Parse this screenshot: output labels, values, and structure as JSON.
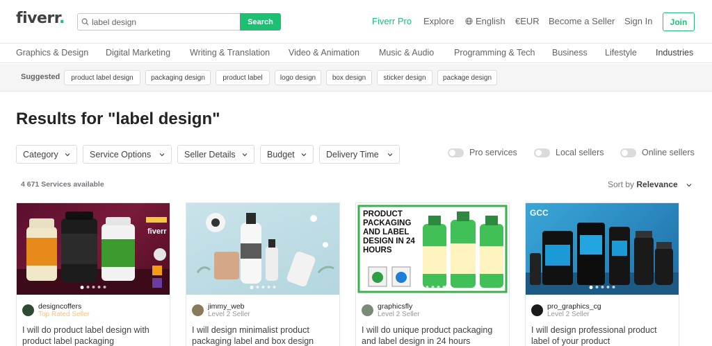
{
  "header": {
    "logo": "fiverr",
    "search": {
      "value": "label design",
      "button": "Search"
    },
    "nav": [
      "Fiverr Pro",
      "Explore",
      "English",
      "€EUR",
      "Become a Seller",
      "Sign In"
    ],
    "join": "Join"
  },
  "categories": [
    "Graphics & Design",
    "Digital Marketing",
    "Writing & Translation",
    "Video & Animation",
    "Music & Audio",
    "Programming & Tech",
    "Business",
    "Lifestyle",
    "Industries"
  ],
  "suggested": {
    "label": "Suggested",
    "chips": [
      "product label design",
      "packaging design",
      "product label",
      "logo design",
      "box design",
      "sticker design",
      "package design"
    ]
  },
  "results_title": "Results for \"label design\"",
  "filters": [
    "Category",
    "Service Options",
    "Seller Details",
    "Budget",
    "Delivery Time"
  ],
  "toggles": [
    "Pro services",
    "Local sellers",
    "Online sellers"
  ],
  "count": "4 671 Services available",
  "sort": {
    "label": "Sort by",
    "value": "Relevance"
  },
  "gigs": [
    {
      "seller": "designcoffers",
      "level": "Top Rated Seller",
      "title": "I will do product label design with product label packaging",
      "thumb_text": "fiverr"
    },
    {
      "seller": "jimmy_web",
      "level": "Level 2 Seller",
      "title": "I will design minimalist product packaging label and box design",
      "thumb_text": ""
    },
    {
      "seller": "graphicsfly",
      "level": "Level 2 Seller",
      "title": "I will do unique product packaging and label design in 24 hours",
      "thumb_text": "PRODUCT PACKAGING AND LABEL DESIGN IN 24 HOURS"
    },
    {
      "seller": "pro_graphics_cg",
      "level": "Level 2 Seller",
      "title": "I will design professional product label of your product",
      "thumb_text": "GCC"
    }
  ],
  "colors": {
    "brand": "#1dbf73",
    "text": "#404145",
    "top_rated": "#f7c17b"
  }
}
